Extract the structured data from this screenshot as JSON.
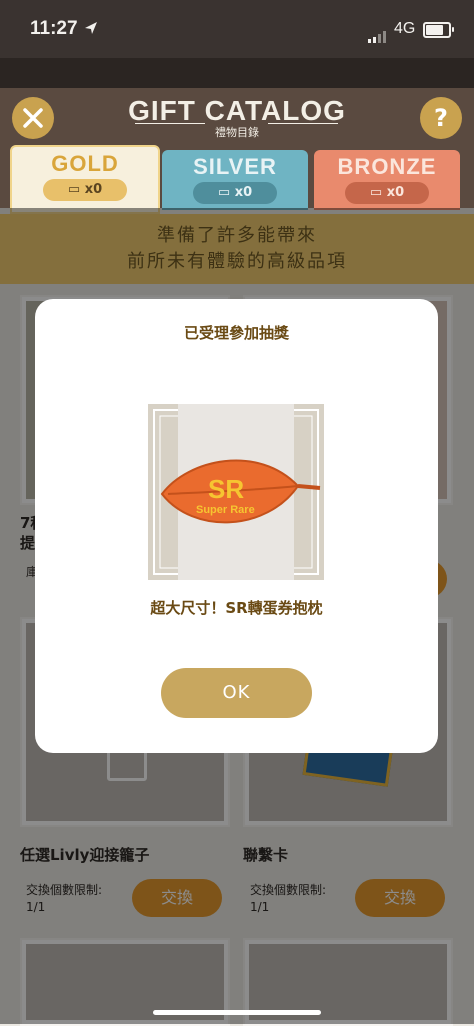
{
  "status_bar": {
    "time": "11:27",
    "network": "4G"
  },
  "header": {
    "title": "GIFT CATALOG",
    "subtitle": "禮物目錄",
    "close_icon": "x-close-icon",
    "help_label": "?"
  },
  "tabs": [
    {
      "name": "GOLD",
      "count": "x0"
    },
    {
      "name": "SILVER",
      "count": "x0"
    },
    {
      "name": "BRONZE",
      "count": "x0"
    }
  ],
  "banner": {
    "line1": "準備了許多能帶來",
    "line2": "前所未有體驗的高級品項"
  },
  "cards": [
    {
      "name": "7種",
      "name2": "提",
      "small": "庫"
    },
    {
      "name": "",
      "small": ""
    },
    {
      "name": "任選Livly迎接籠子",
      "limit_label": "交換個數限制:",
      "limit_value": "1/1",
      "button": "交換"
    },
    {
      "name": "聯繫卡",
      "limit_label": "交換個數限制:",
      "limit_value": "1/1",
      "button": "交換"
    }
  ],
  "modal": {
    "title": "已受理參加抽獎",
    "prize_label_big": "SR",
    "prize_label_small": "Super Rare",
    "prize_name": "超大尺寸！SR轉蛋券抱枕",
    "ok_label": "OK"
  },
  "colors": {
    "gold_tab": "#f7f0dd",
    "silver_tab": "#6fb4c3",
    "bronze_tab": "#e98a6d",
    "accent": "#c8a75f"
  }
}
